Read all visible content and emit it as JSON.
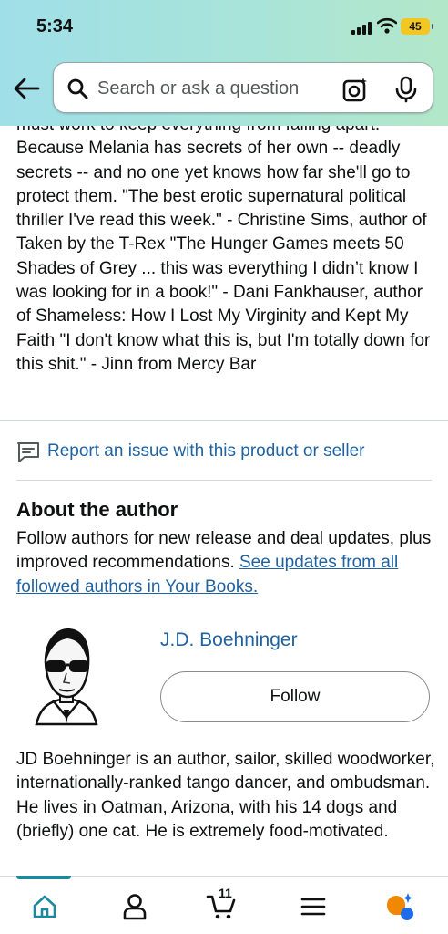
{
  "status_bar": {
    "time": "5:34",
    "battery": "45"
  },
  "search": {
    "placeholder": "Search or ask a question"
  },
  "description": "must work to keep everything from falling apart. Because Melania has secrets of her own -- deadly secrets -- and no one yet knows how far she'll go to protect them. \"The best erotic supernatural political thriller I've read this week.\" - Christine Sims, author of Taken by the T-Rex \"The Hunger Games meets 50 Shades of Grey ... this was everything I didn’t know I was looking for in a book!\" - Dani Fankhauser, author of Shameless: How I Lost My Virginity and Kept My Faith \"I don't know what this is, but I'm totally down for this shit.\" - Jinn from Mercy Bar",
  "report": {
    "label": "Report an issue with this product or seller"
  },
  "about": {
    "title": "About the author",
    "text": "Follow authors for new release and deal updates, plus improved recommendations.",
    "link": "See updates from all followed authors in Your Books."
  },
  "author": {
    "name": "J.D. Boehninger",
    "follow_label": "Follow",
    "bio": "JD Boehninger is an author, sailor, skilled woodworker, internationally-ranked tango dancer, and ombudsman. He lives in Oatman, Arizona, with his 14 dogs and (briefly) one cat. He is extremely food-motivated."
  },
  "nav": {
    "items": [
      "home-icon",
      "account-icon",
      "cart-icon",
      "menu-icon",
      "rufus-icon"
    ],
    "cart_count": "11"
  },
  "colors": {
    "link": "#2162a1",
    "accent": "#1b8a9e",
    "battery": "#f2c623"
  }
}
